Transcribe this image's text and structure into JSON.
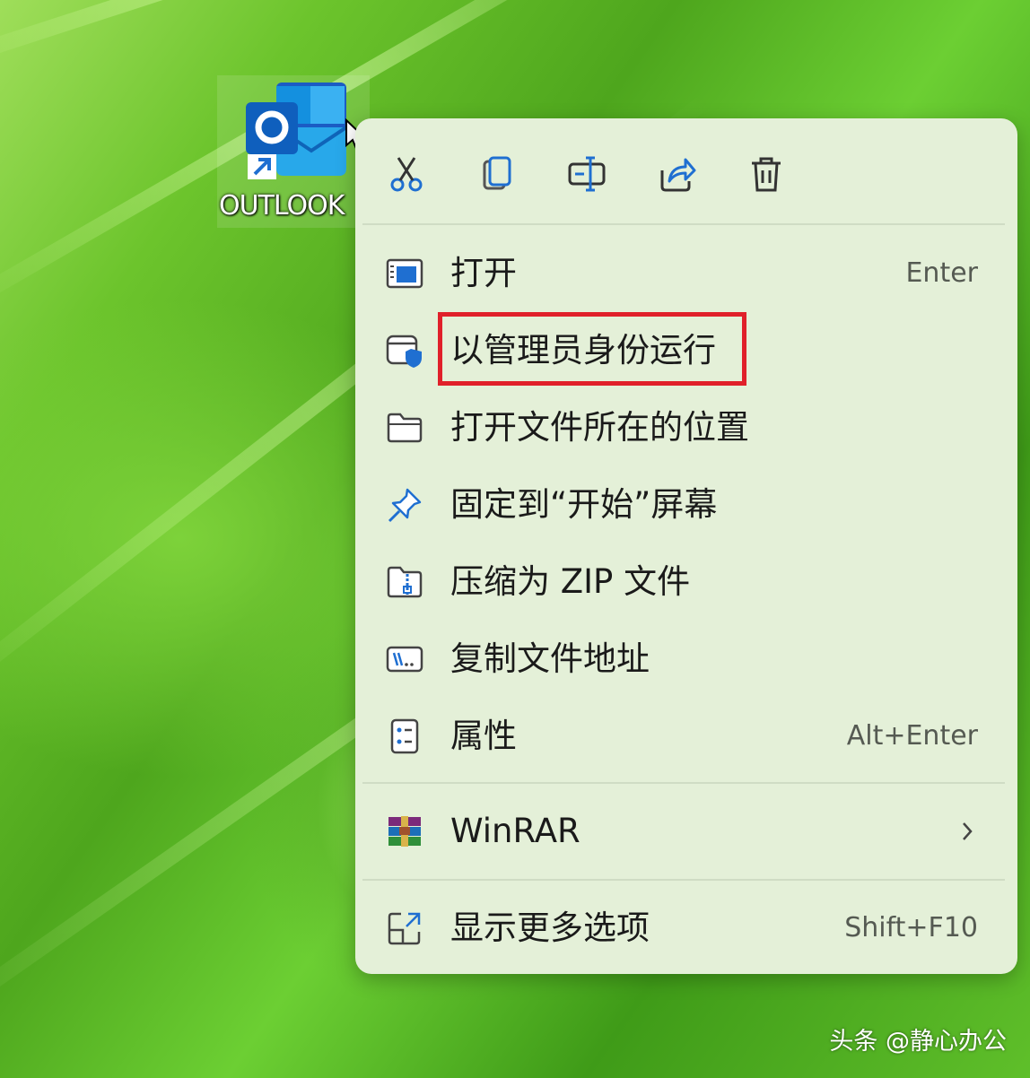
{
  "desktop": {
    "icon_label": "OUTLOOK",
    "icon": "outlook-shortcut-icon"
  },
  "context_menu": {
    "quick_actions": [
      {
        "name": "cut",
        "icon": "scissors-icon"
      },
      {
        "name": "copy",
        "icon": "copy-icon"
      },
      {
        "name": "rename",
        "icon": "rename-icon"
      },
      {
        "name": "share",
        "icon": "share-icon"
      },
      {
        "name": "delete",
        "icon": "trash-icon"
      }
    ],
    "items": [
      {
        "label": "打开",
        "shortcut": "Enter",
        "icon": "open-window-icon"
      },
      {
        "label": "以管理员身份运行",
        "shortcut": "",
        "icon": "admin-shield-icon"
      },
      {
        "label": "打开文件所在的位置",
        "shortcut": "",
        "icon": "folder-icon"
      },
      {
        "label": "固定到“开始”屏幕",
        "shortcut": "",
        "icon": "pin-icon"
      },
      {
        "label": "压缩为 ZIP 文件",
        "shortcut": "",
        "icon": "zip-folder-icon"
      },
      {
        "label": "复制文件地址",
        "shortcut": "",
        "icon": "path-icon"
      },
      {
        "label": "属性",
        "shortcut": "Alt+Enter",
        "icon": "properties-icon"
      }
    ],
    "winrar": {
      "label": "WinRAR",
      "icon": "winrar-icon"
    },
    "more_options": {
      "label": "显示更多选项",
      "shortcut": "Shift+F10",
      "icon": "more-options-icon"
    }
  },
  "watermark": "头条 @静心办公",
  "colors": {
    "menu_bg": "#e4f0d8",
    "highlight": "#e0202a",
    "icon_blue": "#1f6fd1"
  }
}
